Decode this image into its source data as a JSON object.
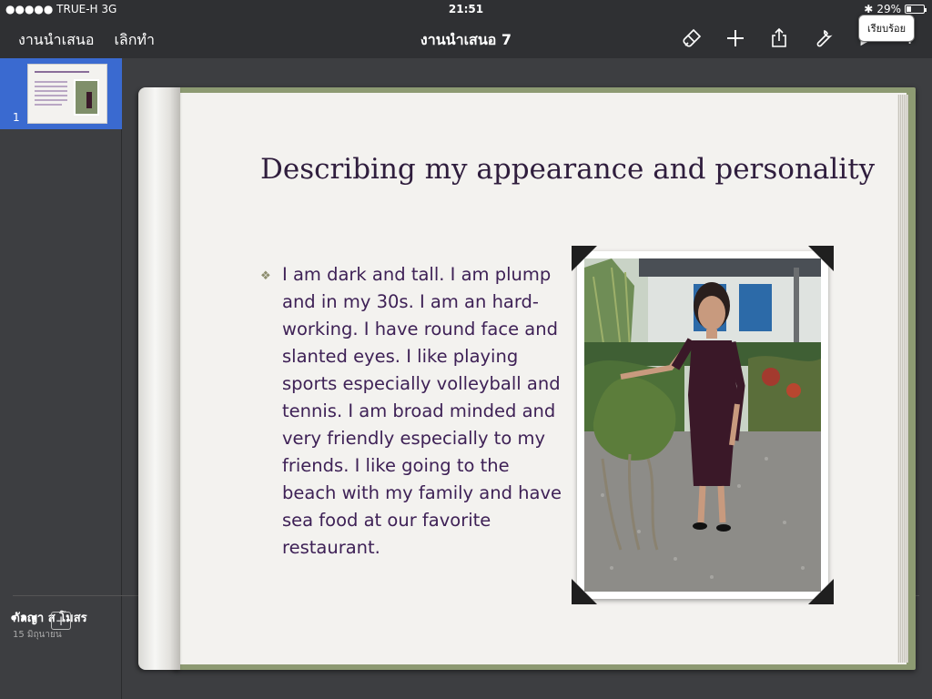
{
  "status_bar": {
    "carrier": "●●●●● TRUE-H  3G",
    "time": "21:51",
    "bluetooth": "✱",
    "battery_percent": "29%",
    "battery_level": 0.29
  },
  "toolbar": {
    "presentations_label": "งานนำเสนอ",
    "undo_label": "เลิกทำ",
    "document_title": "งานนำเสนอ 7",
    "help_label": "?",
    "tooltip": "เรียบร้อย"
  },
  "sidebar": {
    "slide_number": "1",
    "author": "กัลญา ส โมสร",
    "date": "15 มิถุนายน",
    "more_label": "•••",
    "add_label": "+"
  },
  "slide": {
    "title": "Describing my appearance and personality",
    "bullet_marker": "❖",
    "bullet_text": "I am dark and tall. I am plump and in my 30s. I am an hard-working. I have round face and slanted eyes. I like playing sports especially volleyball and tennis. I am broad minded and very friendly especially to my friends. I like going to the beach with my family and have sea food at our favorite restaurant."
  },
  "icons": [
    "brush-icon",
    "plus-icon",
    "share-icon",
    "wrench-icon",
    "play-icon",
    "help-icon"
  ]
}
